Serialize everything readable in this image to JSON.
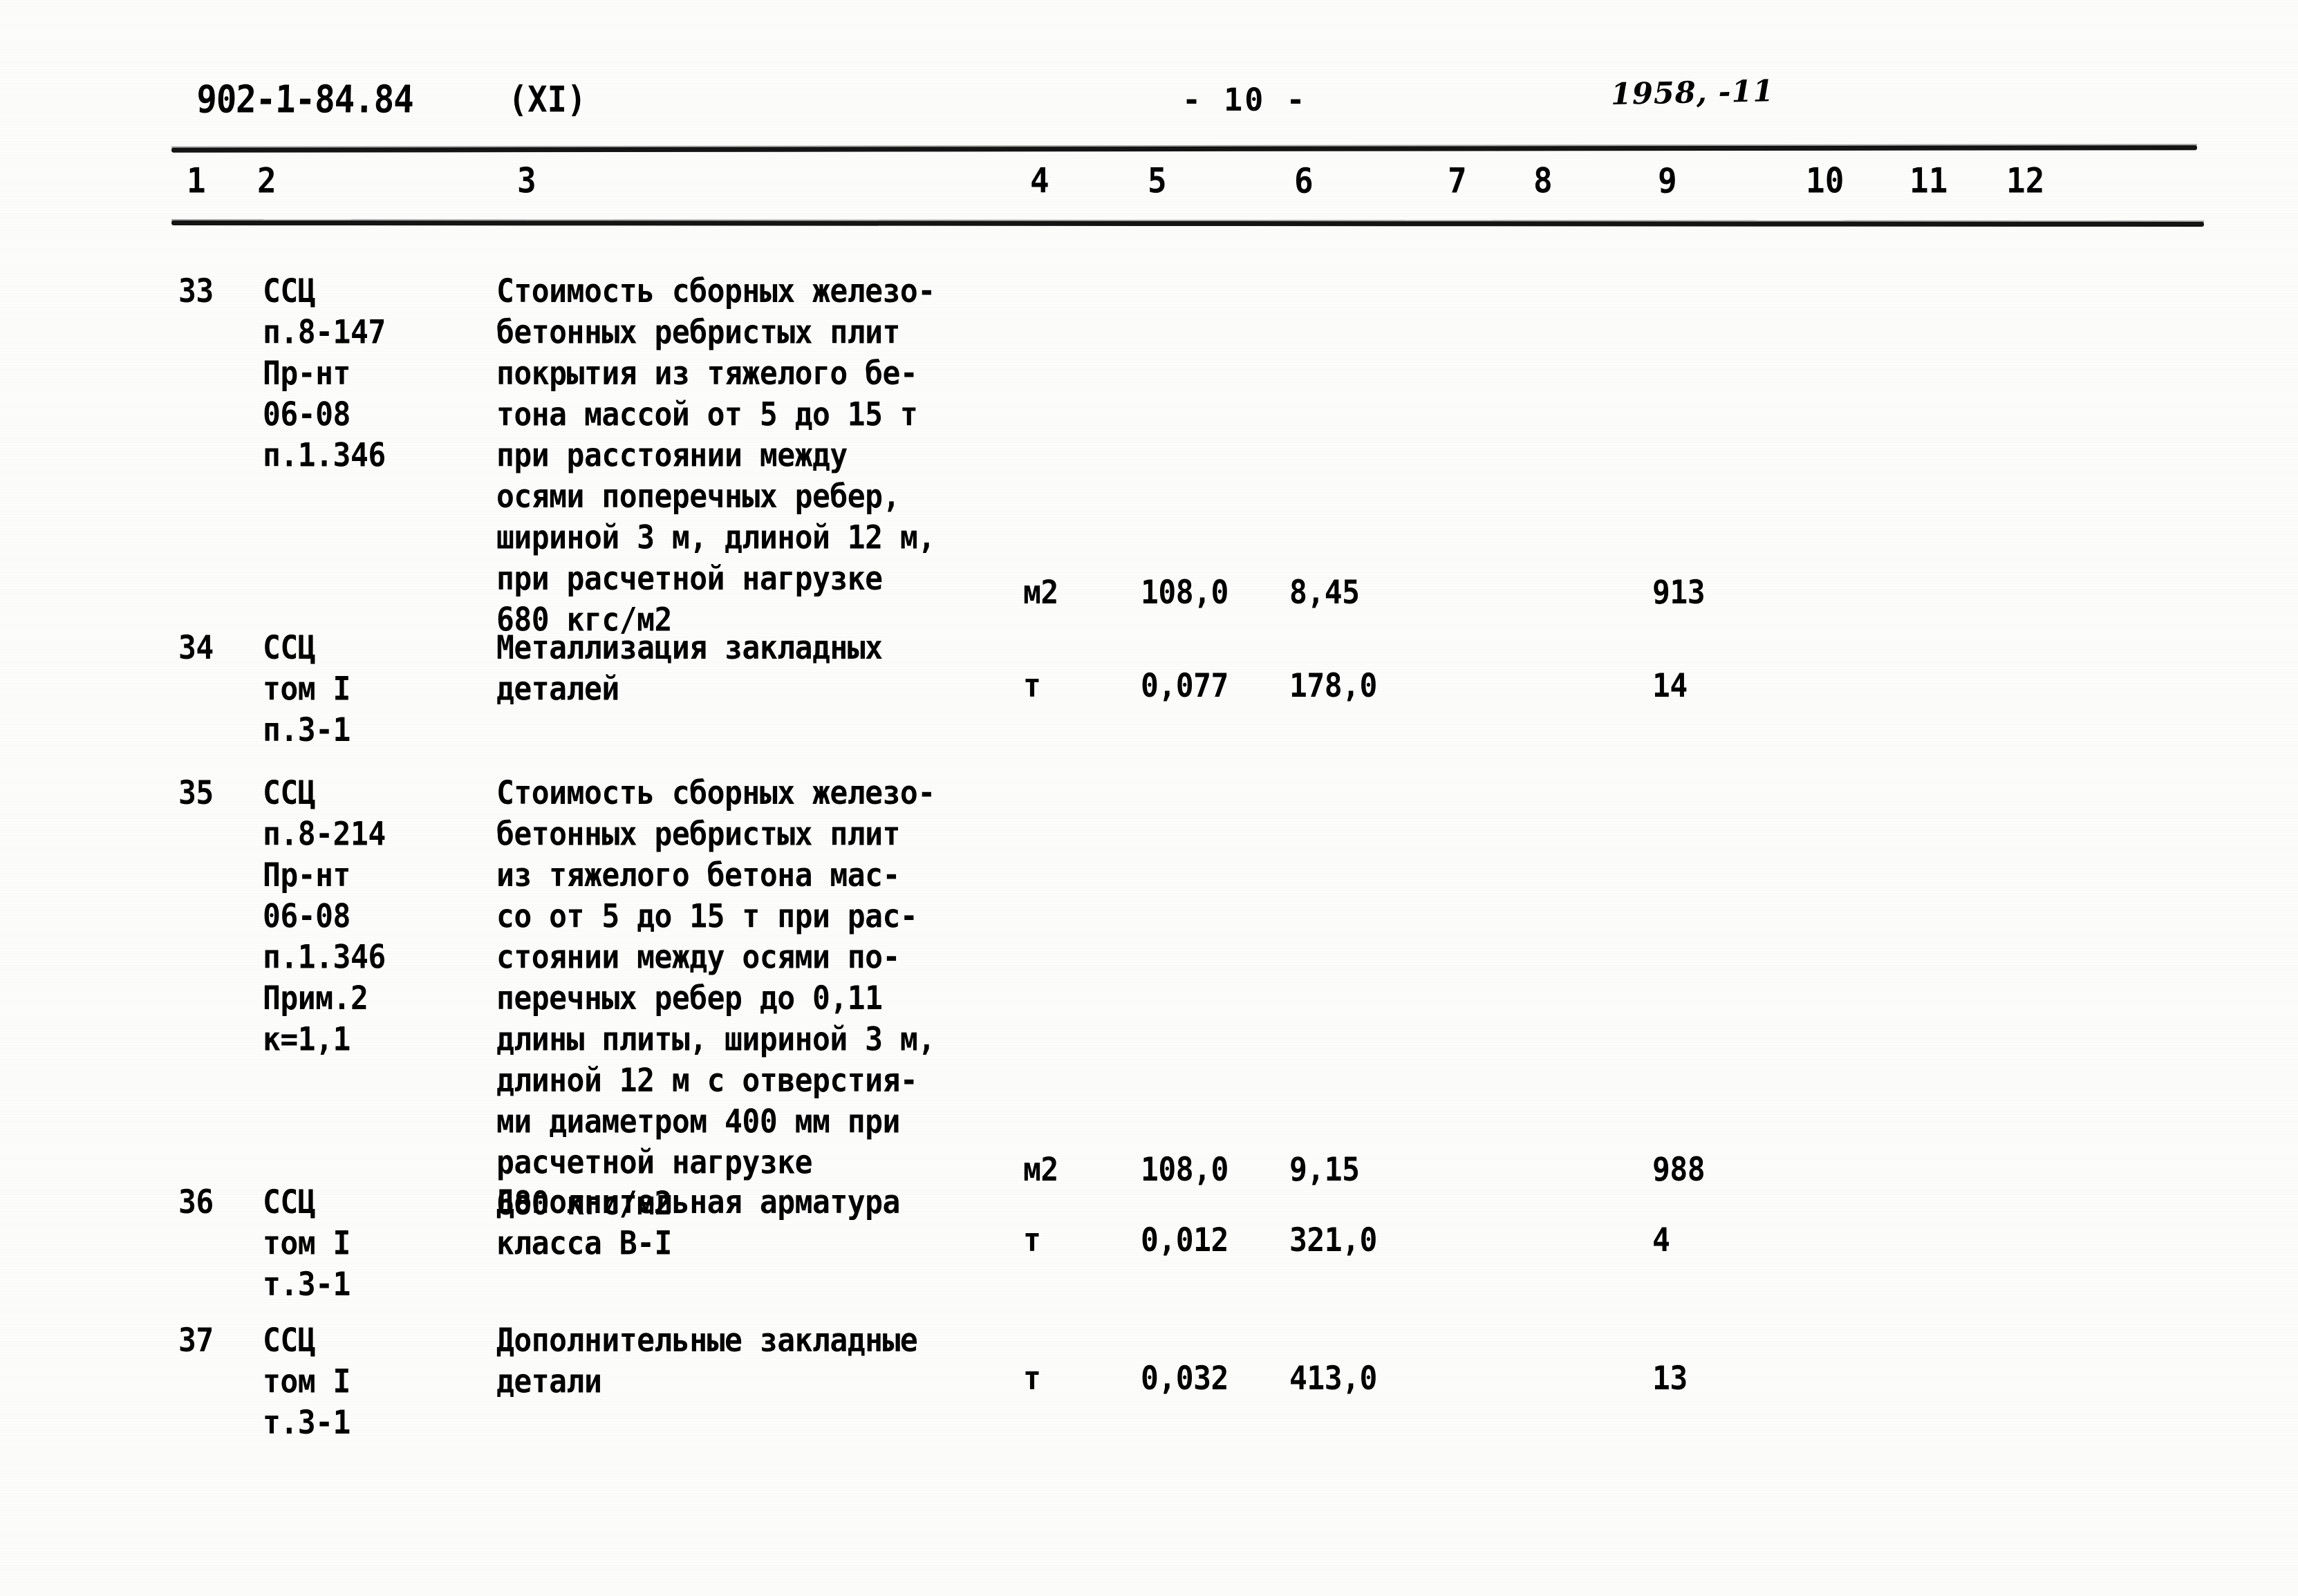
{
  "header": {
    "doc_code": "902-1-84.84",
    "volume": "(XI)",
    "page_number": "- 10 -",
    "handwritten_note": "1958, -11"
  },
  "table": {
    "column_numbers": [
      "1",
      "2",
      "3",
      "4",
      "5",
      "6",
      "7",
      "8",
      "9",
      "10",
      "11",
      "12"
    ],
    "rows": [
      {
        "no": "33",
        "justification": "ССЦ\nп.8-147\nПр-нт\n06-08\nп.1.346",
        "description": "Стоимость сборных железо-\nбетонных ребристых плит\nпокрытия из тяжелого бе-\nтона массой от 5 до 15 т\nпри расстоянии между\nосями поперечных ребер,\nшириной 3 м, длиной 12 м,\nпри расчетной нагрузке\n680 кгс/м2",
        "unit": "м2",
        "quantity": "108,0",
        "price": "8,45",
        "col7": "",
        "col8": "",
        "total": "913",
        "col10": "",
        "col11": "",
        "col12": "",
        "num_line_index": 8
      },
      {
        "no": "34",
        "justification": "ССЦ\nтом I\nп.3-1",
        "description": "Металлизация закладных\nдеталей",
        "unit": "т",
        "quantity": "0,077",
        "price": "178,0",
        "col7": "",
        "col8": "",
        "total": "14",
        "col10": "",
        "col11": "",
        "col12": "",
        "num_line_index": 1
      },
      {
        "no": "35",
        "justification": "ССЦ\nп.8-214\nПр-нт\n06-08\nп.1.346\nПрим.2\nк=1,1",
        "description": "Стоимость сборных железо-\nбетонных ребристых плит\nиз тяжелого бетона мас-\nсо от 5 до 15 т при рас-\nстоянии между осями по-\nперечных ребер до 0,11\nдлины плиты, шириной 3 м,\nдлиной 12 м с отверстия-\nми диаметром 400 мм при\nрасчетной нагрузке\n680 кгс/м2",
        "unit": "м2",
        "quantity": "108,0",
        "price": "9,15",
        "col7": "",
        "col8": "",
        "total": "988",
        "col10": "",
        "col11": "",
        "col12": "",
        "num_line_index": 10
      },
      {
        "no": "36",
        "justification": "ССЦ\nтом I\nт.3-1",
        "description": "Дополнительная арматура\nкласса B-I",
        "unit": "т",
        "quantity": "0,012",
        "price": "321,0",
        "col7": "",
        "col8": "",
        "total": "4",
        "col10": "",
        "col11": "",
        "col12": "",
        "num_line_index": 1
      },
      {
        "no": "37",
        "justification": "ССЦ\nтом I\nт.3-1",
        "description": "Дополнительные закладные\nдетали",
        "unit": "т",
        "quantity": "0,032",
        "price": "413,0",
        "col7": "",
        "col8": "",
        "total": "13",
        "col10": "",
        "col11": "",
        "col12": "",
        "num_line_index": 1
      }
    ]
  }
}
